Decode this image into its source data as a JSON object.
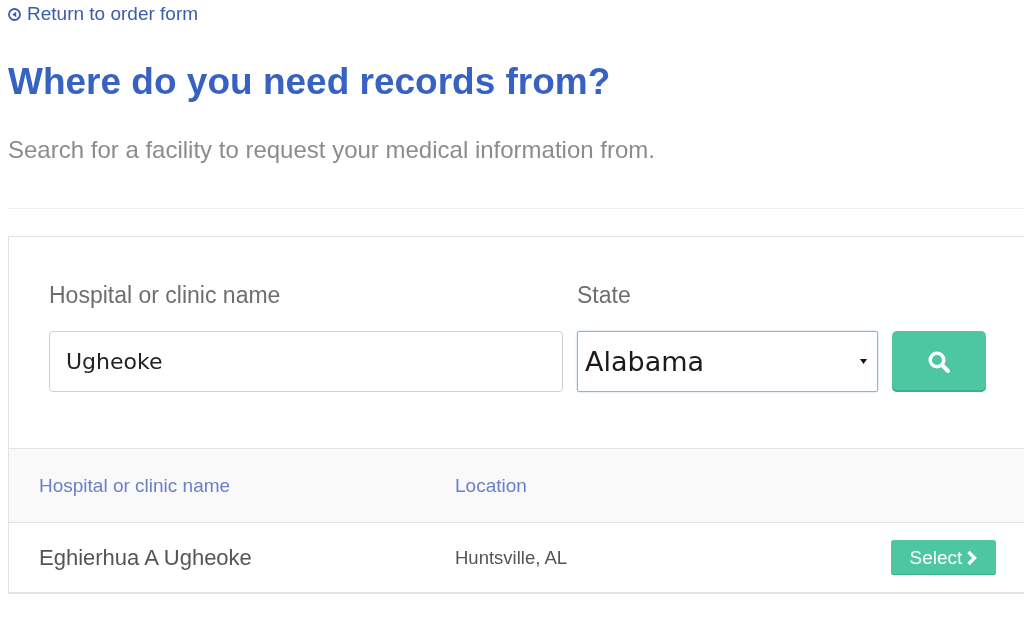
{
  "back_link": {
    "label": "Return to order form"
  },
  "heading": "Where do you need records from?",
  "subtitle": "Search for a facility to request your medical information from.",
  "search_form": {
    "name_field": {
      "label": "Hospital or clinic name",
      "value": "Ugheoke",
      "focused": false
    },
    "state_field": {
      "label": "State",
      "value": "Alabama",
      "focused": true
    }
  },
  "results": {
    "columns": [
      "Hospital or clinic name",
      "Location"
    ],
    "rows": [
      {
        "name": "Eghierhua A Ugheoke",
        "location": "Huntsville, AL",
        "action": "Select"
      }
    ]
  }
}
